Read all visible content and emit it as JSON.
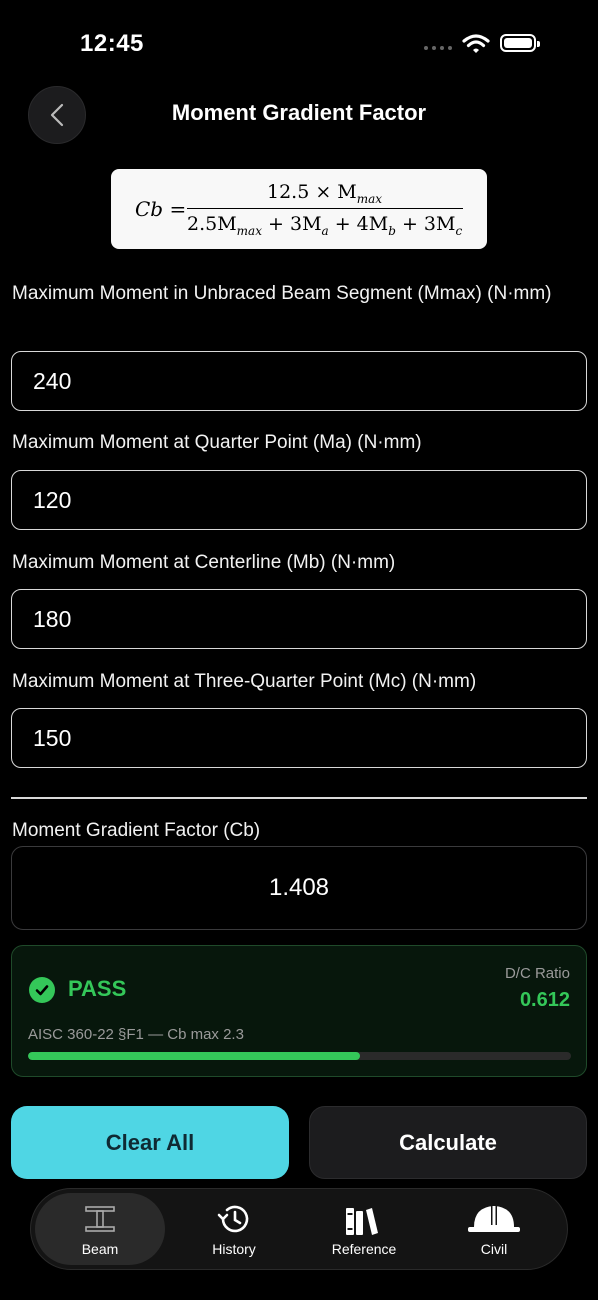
{
  "status_bar": {
    "time": "12:45"
  },
  "header": {
    "title": "Moment Gradient Factor"
  },
  "formula": {
    "lhs": "Cb =",
    "numerator": "12.5 × M",
    "numerator_sub": "max",
    "denominator": [
      "2.5M",
      "max",
      " + 3M",
      "a",
      " + 4M",
      "b",
      " + 3M",
      "c"
    ]
  },
  "inputs": [
    {
      "label": "Maximum Moment in Unbraced Beam Segment (Mmax) (N·mm)",
      "value": "240"
    },
    {
      "label": "Maximum Moment at Quarter Point (Ma) (N·mm)",
      "value": "120"
    },
    {
      "label": "Maximum Moment at Centerline (Mb) (N·mm)",
      "value": "180"
    },
    {
      "label": "Maximum Moment at Three-Quarter Point (Mc) (N·mm)",
      "value": "150"
    }
  ],
  "result": {
    "label": "Moment Gradient Factor (Cb)",
    "value": "1.408"
  },
  "check": {
    "status": "PASS",
    "ratio_label": "D/C Ratio",
    "ratio_value": "0.612",
    "reference": "AISC 360-22 §F1 — Cb max 2.3",
    "progress": 0.612,
    "color": "#34c759"
  },
  "buttons": {
    "clear": "Clear All",
    "calculate": "Calculate"
  },
  "tabs": [
    {
      "label": "Beam",
      "icon": "beam-icon",
      "active": true
    },
    {
      "label": "History",
      "icon": "history-icon",
      "active": false
    },
    {
      "label": "Reference",
      "icon": "books-icon",
      "active": false
    },
    {
      "label": "Civil",
      "icon": "hardhat-icon",
      "active": false
    }
  ]
}
